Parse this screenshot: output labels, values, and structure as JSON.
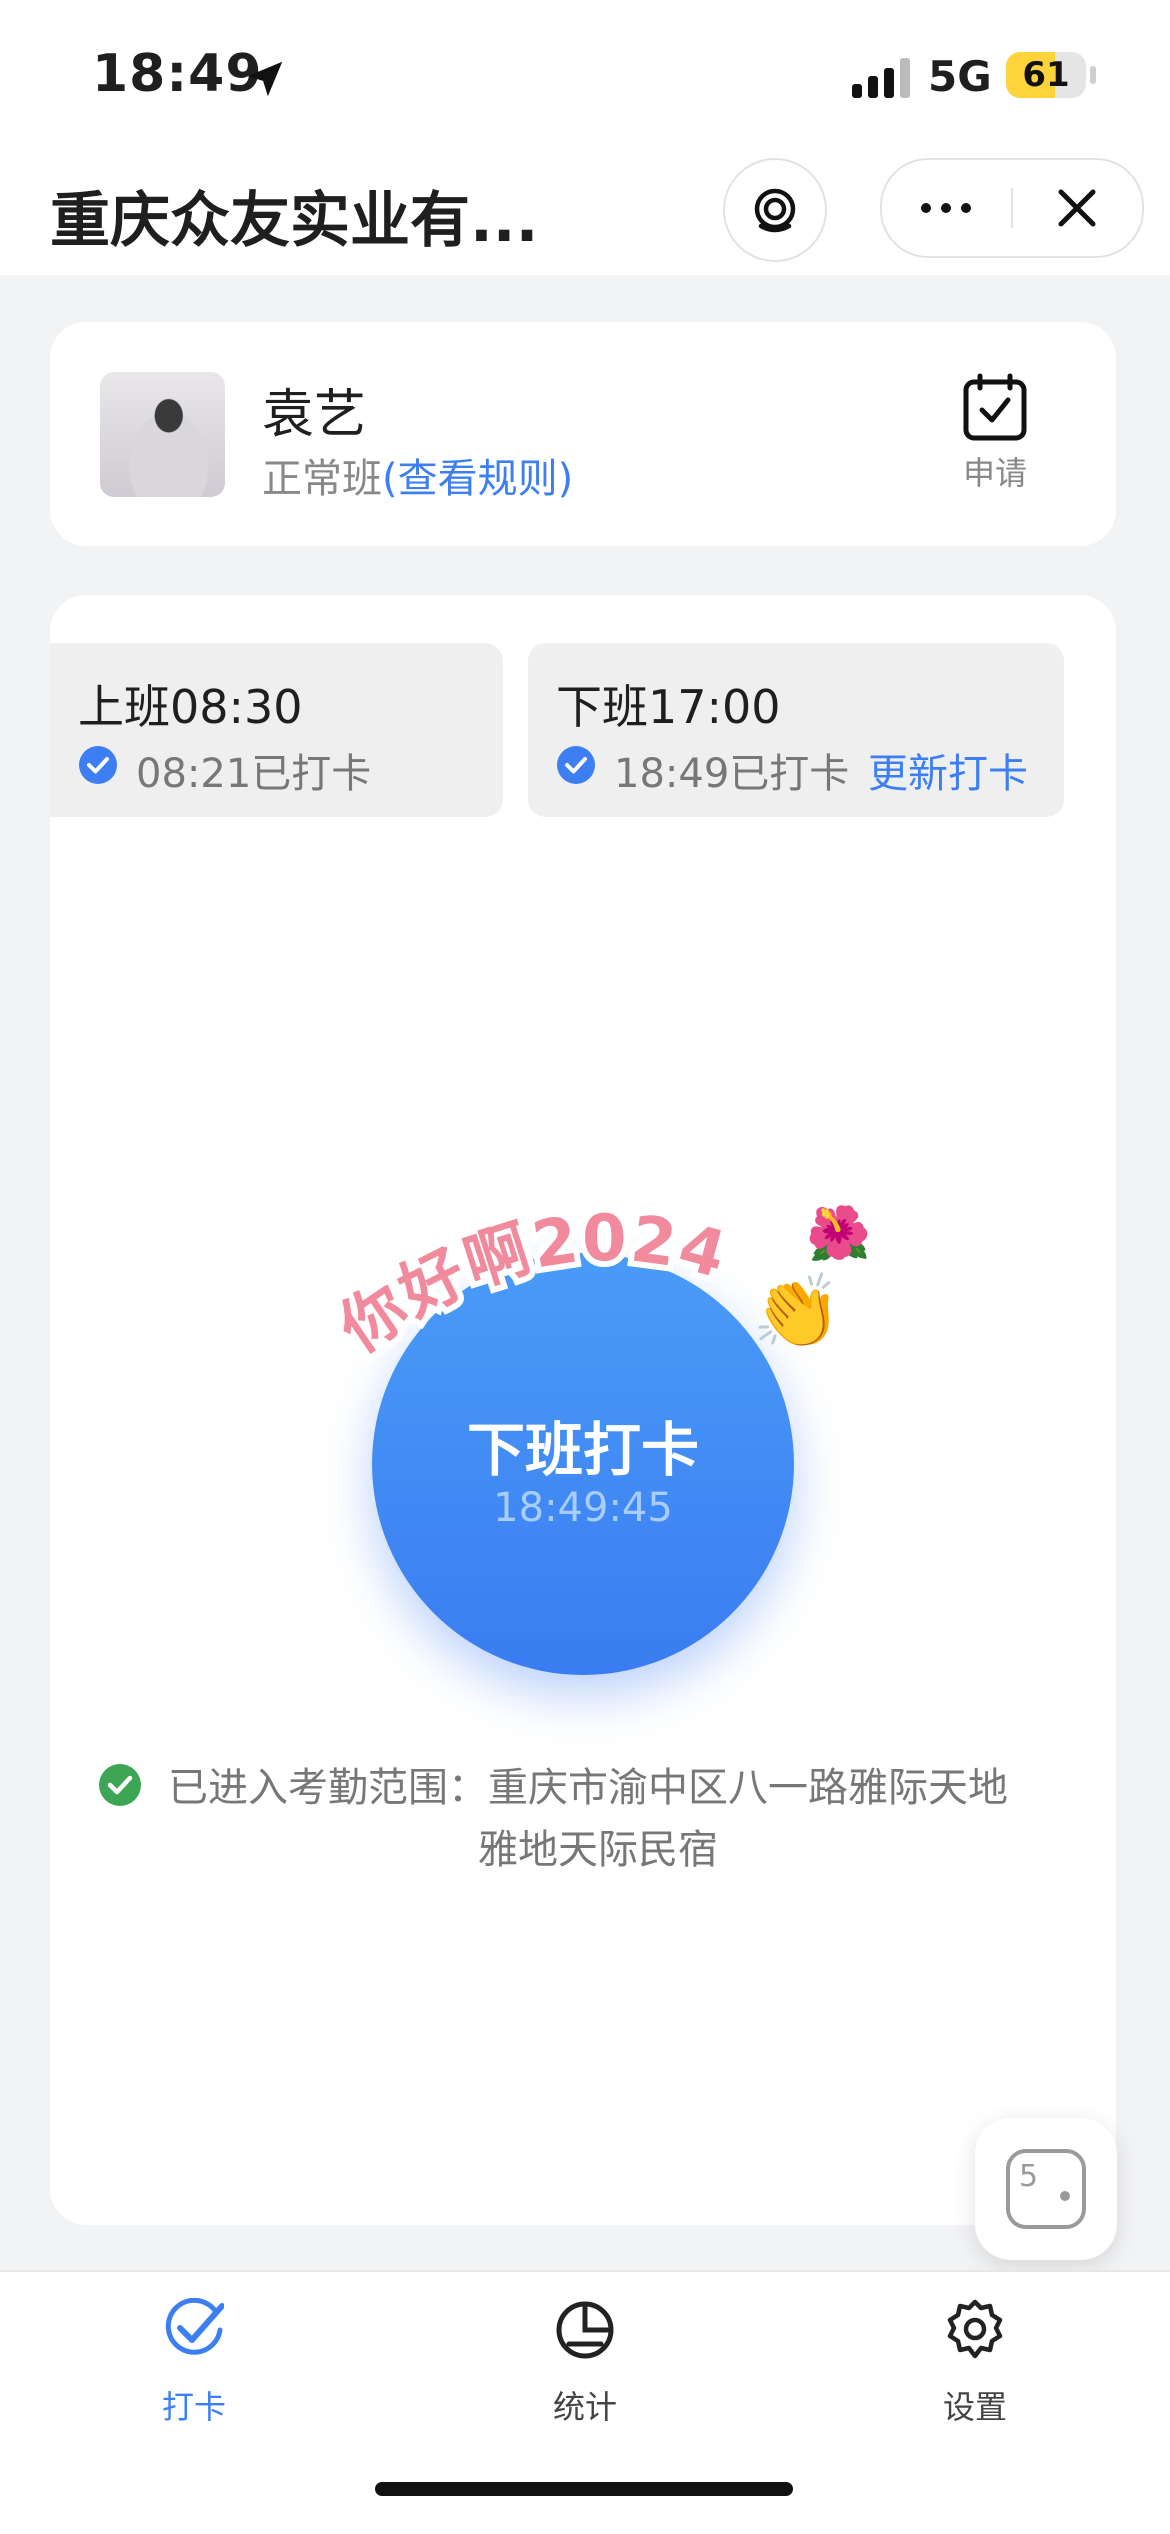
{
  "status_bar": {
    "time": "18:49",
    "network": "5G",
    "battery": "61",
    "battery_level": 0.61
  },
  "nav": {
    "title": "重庆众友实业有..."
  },
  "user": {
    "name": "袁艺",
    "shift_type": "正常班",
    "rule_link": "(查看规则)",
    "apply_label": "申请"
  },
  "shifts": {
    "on_duty": {
      "label": "上班08:30",
      "punched": "08:21已打卡"
    },
    "off_duty": {
      "label": "下班17:00",
      "punched": "18:49已打卡",
      "update": "更新打卡"
    }
  },
  "punch": {
    "label": "下班打卡",
    "clock": "18:49:45",
    "sticker_text": "你好啊2024"
  },
  "range": {
    "line1": "已进入考勤范围：重庆市渝中区八一路雅际天地",
    "line2": "雅地天际民宿"
  },
  "float_button": {
    "badge": "5"
  },
  "tabs": [
    {
      "label": "打卡",
      "icon": "check-icon",
      "active": true
    },
    {
      "label": "统计",
      "icon": "chart-icon",
      "active": false
    },
    {
      "label": "设置",
      "icon": "gear-icon",
      "active": false
    }
  ],
  "colors": {
    "accent": "#3d7ff2",
    "success": "#3ca655",
    "battery": "#ffd43b"
  }
}
